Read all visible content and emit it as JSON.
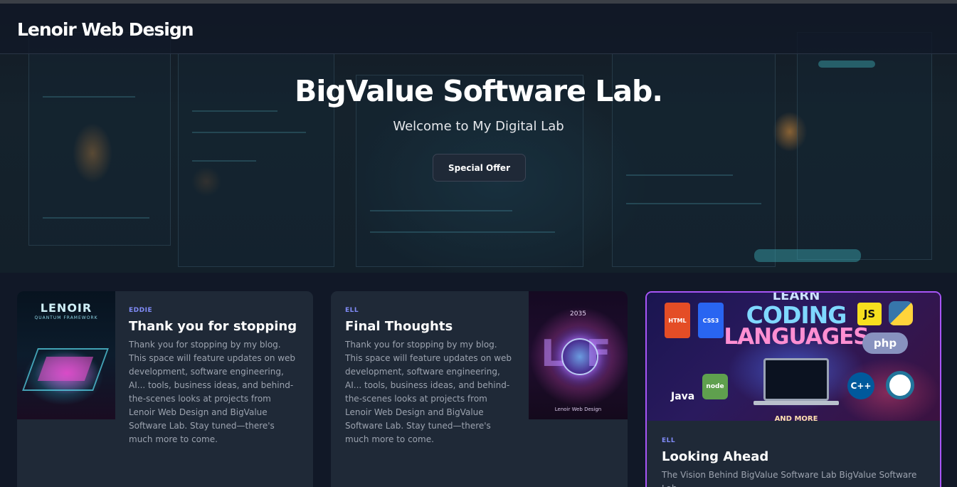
{
  "header": {
    "brand": "Lenoir Web Design"
  },
  "hero": {
    "title": "BigValue Software Lab.",
    "subtitle": "Welcome to My Digital Lab",
    "cta_label": "Special Offer"
  },
  "posts": [
    {
      "author": "EDDIE",
      "title": "Thank you for stopping",
      "excerpt": "Thank you for stopping by my blog. This space will feature updates on web development, software engineering, AI... tools, business ideas, and behind-the-scenes looks at projects from Lenoir Web Design and BigValue Software Lab. Stay tuned—there's much more to come.",
      "image": {
        "title": "LENOIR",
        "subtitle": "QUANTUM FRAMEWORK"
      }
    },
    {
      "author": "ELL",
      "title": "Final Thoughts",
      "excerpt": "Thank you for stopping by my blog. This space will feature updates on web development, software engineering, AI... tools, business ideas, and behind-the-scenes looks at projects from Lenoir Web Design and BigValue Software Lab. Stay tuned—there's much more to come.",
      "image": {
        "year": "2035",
        "letters": "L  F",
        "caption": "Lenoir Web Design"
      }
    },
    {
      "author": "ELL",
      "title": "Looking Ahead",
      "excerpt": "The Vision Behind BigValue Software Lab BigValue Software Lab",
      "image": {
        "top": "LEARN",
        "line1": "CODING",
        "line2": "LANGUAGES",
        "bottom": "AND MORE",
        "html": "HTML",
        "css": "CSS3",
        "js": "JS",
        "php": "php",
        "java": "Java",
        "node": "node",
        "cpp": "C++"
      }
    }
  ],
  "colors": {
    "accent": "#818cf8",
    "highlight_border": "#a855f7",
    "card_bg": "#1f2937",
    "page_bg": "#111827"
  }
}
